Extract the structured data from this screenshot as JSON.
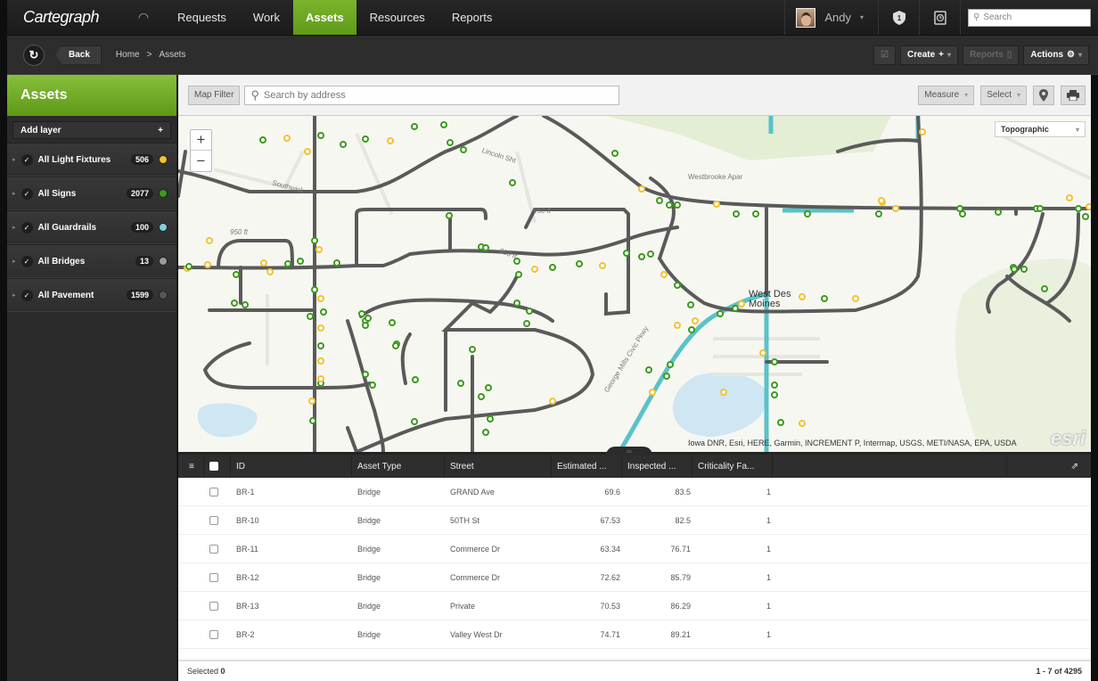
{
  "app": {
    "logo": "Cartegraph"
  },
  "nav": {
    "items": [
      {
        "label": "Requests"
      },
      {
        "label": "Work"
      },
      {
        "label": "Assets",
        "active": true
      },
      {
        "label": "Resources"
      },
      {
        "label": "Reports"
      }
    ],
    "user": "Andy",
    "search_placeholder": "Search"
  },
  "subbar": {
    "back_label": "Back",
    "breadcrumb": [
      "Home",
      ">",
      "Assets"
    ],
    "create_label": "Create",
    "reports_label": "Reports",
    "actions_label": "Actions"
  },
  "sidebar": {
    "title": "Assets",
    "add_layer_label": "Add layer",
    "layers": [
      {
        "name": "All Light Fixtures",
        "count": "506",
        "color": "#f2c230"
      },
      {
        "name": "All Signs",
        "count": "2077",
        "color": "#3c9a1e"
      },
      {
        "name": "All Guardrails",
        "count": "100",
        "color": "#7fd0d8"
      },
      {
        "name": "All Bridges",
        "count": "13",
        "color": "#9a9a9a"
      },
      {
        "name": "All Pavement",
        "count": "1599",
        "color": "#555555"
      }
    ]
  },
  "maptoolbar": {
    "map_filter_label": "Map Filter",
    "address_placeholder": "Search by address",
    "measure_label": "Measure",
    "select_label": "Select"
  },
  "map": {
    "basemap": "Topographic",
    "attribution": "Iowa DNR, Esri, HERE, Garmin, INCREMENT P, Intermap, USGS, METI/NASA, EPA, USDA",
    "esri_logo": "esri",
    "labels": [
      "Lincoln Sht",
      "Southwick",
      "950 ft",
      "950 ft",
      "950 ft",
      "Westbrooke Apar",
      "West Des Moines",
      "George Mills Civic Pkwy"
    ]
  },
  "grid": {
    "columns": [
      "ID",
      "Asset Type",
      "Street",
      "Estimated ...",
      "Inspected ...",
      "Criticality Fa..."
    ],
    "rows": [
      {
        "id": "BR-1",
        "type": "Bridge",
        "street": "GRAND Ave",
        "est": "69.6",
        "insp": "83.5",
        "crit": "1"
      },
      {
        "id": "BR-10",
        "type": "Bridge",
        "street": "50TH St",
        "est": "67.53",
        "insp": "82.5",
        "crit": "1"
      },
      {
        "id": "BR-11",
        "type": "Bridge",
        "street": "Commerce Dr",
        "est": "63.34",
        "insp": "76.71",
        "crit": "1"
      },
      {
        "id": "BR-12",
        "type": "Bridge",
        "street": "Commerce Dr",
        "est": "72.62",
        "insp": "85.79",
        "crit": "1"
      },
      {
        "id": "BR-13",
        "type": "Bridge",
        "street": "Private",
        "est": "70.53",
        "insp": "86.29",
        "crit": "1"
      },
      {
        "id": "BR-2",
        "type": "Bridge",
        "street": "Valley West Dr",
        "est": "74.71",
        "insp": "89.21",
        "crit": "1"
      }
    ],
    "selected_label": "Selected",
    "selected_count": "0",
    "pagination": "1 - 7 of 4295"
  }
}
